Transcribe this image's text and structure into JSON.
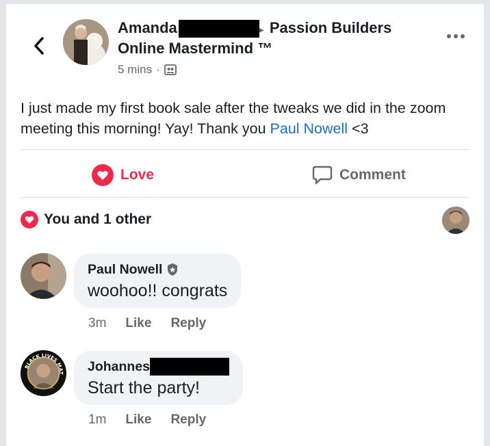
{
  "post": {
    "author_first": "Amanda",
    "arrow": "▸",
    "group_line1": "Passion Builders",
    "group_line2": "Online Mastermind ™",
    "time": "5 mins",
    "separator": "·",
    "privacy_icon": "group-members-icon",
    "text_before": "I just made my first book sale after the tweaks we did in the zoom meeting this morning! Yay! Thank you ",
    "mention": "Paul Nowell",
    "text_after": " <3"
  },
  "actions": {
    "love_label": "Love",
    "comment_label": "Comment",
    "love_color": "#f0284a"
  },
  "reactions": {
    "summary": "You and 1 other"
  },
  "comments": [
    {
      "name": "Paul Nowell",
      "badge_icon": "admin-shield-icon",
      "text": "woohoo!! congrats",
      "time": "3m",
      "like": "Like",
      "reply": "Reply"
    },
    {
      "name": "Johannes",
      "text": "Start the party!",
      "time": "1m",
      "like": "Like",
      "reply": "Reply",
      "avatar_ring_text": "BLACK LIVES MATTER"
    }
  ],
  "colors": {
    "link": "#1b6ec2",
    "secondary_text": "#65676b",
    "bubble": "#f0f2f5"
  }
}
